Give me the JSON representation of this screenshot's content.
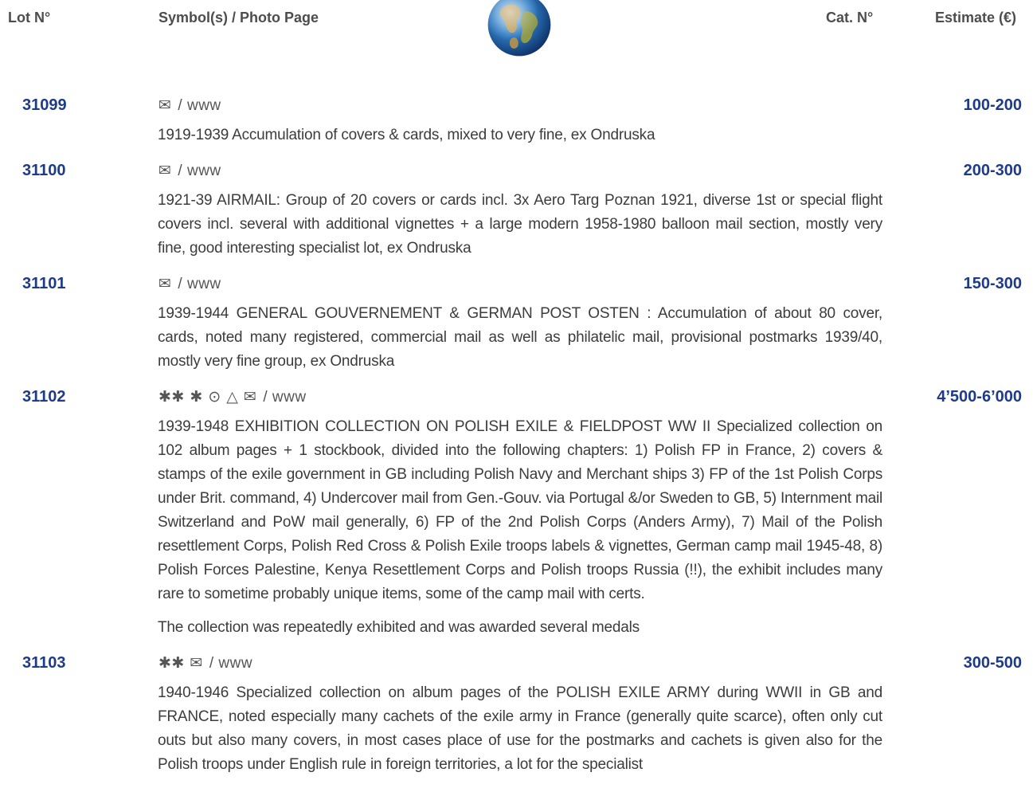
{
  "header": {
    "lot_label": "Lot N°",
    "symbol_label": "Symbol(s) / Photo Page",
    "cat_label": "Cat. N°",
    "estimate_label": "Estimate (€)",
    "colors": {
      "accent": "#1e3b8a",
      "text": "#3a3a3a"
    }
  },
  "lots": [
    {
      "number": "31099",
      "symbols": "✉",
      "photo": "/ www",
      "estimate": "100-200",
      "description": "1919-1939 Accumulation of covers & cards, mixed to very fine, ex Ondruska"
    },
    {
      "number": "31100",
      "symbols": "✉",
      "photo": "/ www",
      "estimate": "200-300",
      "description": "1921-39 AIRMAIL: Group of 20 covers or cards incl. 3x Aero Targ Poznan 1921, diverse 1st or special flight covers incl. several with additional vignettes + a large modern 1958-1980 balloon mail section, mostly very fine, good interesting specialist lot, ex Ondruska"
    },
    {
      "number": "31101",
      "symbols": "✉",
      "photo": "/ www",
      "estimate": "150-300",
      "description": "1939-1944 GENERAL GOUVERNEMENT & GERMAN POST OSTEN : Accumulation of about 80 cover, cards, noted many registered, commercial mail as well as philatelic mail, provisional postmarks 1939/40, mostly very fine group, ex Ondruska"
    },
    {
      "number": "31102",
      "symbols": "✱✱ ✱ ⊙ △ ✉",
      "photo": "/ www",
      "estimate": "4’500-6’000",
      "description": "1939-1948 EXHIBITION COLLECTION ON POLISH EXILE & FIELDPOST WW II Specialized collection on 102 album pages + 1 stockbook, divided into the following chapters: 1) Polish FP in France, 2) covers & stamps of the exile government in GB including Polish Navy and Merchant ships 3) FP of the 1st Polish Corps under Brit. command, 4) Undercover mail from Gen.-Gouv. via Portugal &/or Sweden to GB, 5) Internment mail Switzerland and PoW mail generally, 6) FP of the 2nd Polish Corps (Anders Army), 7) Mail of the Polish resettlement Corps, Polish Red Cross & Polish Exile troops labels & vignettes, German camp mail 1945-48, 8) Polish Forces Palestine, Kenya Resettlement Corps and Polish troops Russia (!!), the exhibit includes many rare to sometime probably unique items, some of the camp mail with certs.",
      "description2": "The collection was repeatedly exhibited and was awarded several medals"
    },
    {
      "number": "31103",
      "symbols": "✱✱ ✉",
      "photo": "/ www",
      "estimate": "300-500",
      "description": "1940-1946 Specialized collection on album pages of the POLISH EXILE ARMY during WWII in GB and FRANCE, noted especially many cachets of the exile army in France (generally quite scarce), often only cut outs but also many covers, in most cases place of use for the postmarks and cachets is given also for the Polish troops under English rule in foreign territories, a lot for the specialist"
    }
  ]
}
